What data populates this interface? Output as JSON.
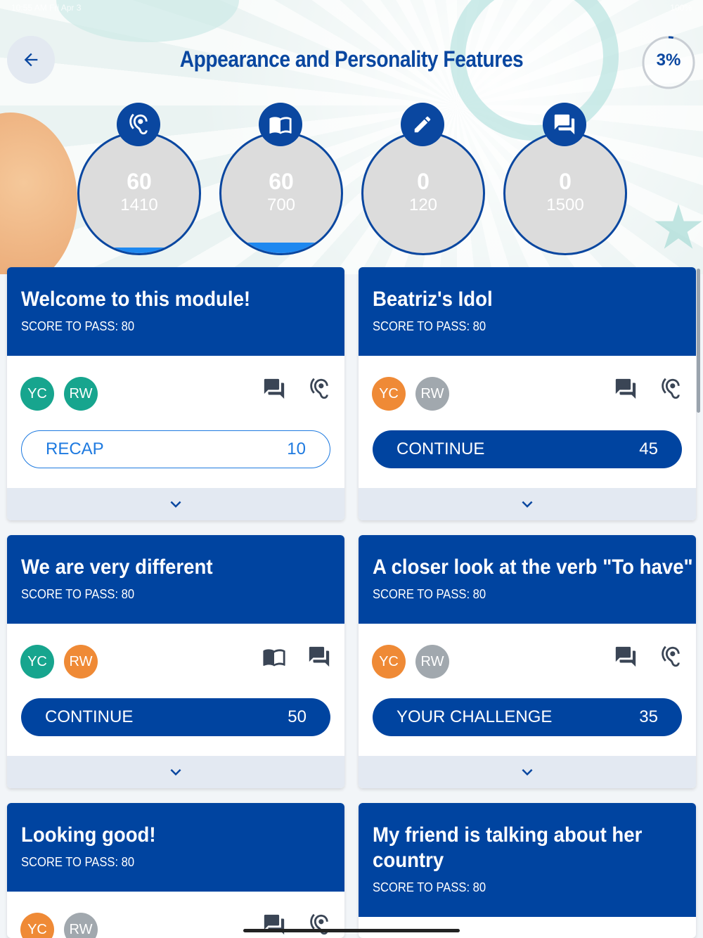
{
  "status_bar": {
    "time": "10:55 AM",
    "date": "Fri Apr 3",
    "battery": "100%"
  },
  "header": {
    "title": "Appearance and Personality Features",
    "progress": "3%",
    "progress_fraction": 0.03
  },
  "skills": [
    {
      "icon": "ear-icon",
      "points": "60",
      "total": "1410",
      "fill_fraction": 0.043
    },
    {
      "icon": "book-icon",
      "points": "60",
      "total": "700",
      "fill_fraction": 0.086
    },
    {
      "icon": "pencil-icon",
      "points": "0",
      "total": "120",
      "fill_fraction": 0
    },
    {
      "icon": "chat-icon",
      "points": "0",
      "total": "1500",
      "fill_fraction": 0
    }
  ],
  "cards": [
    {
      "title": "Welcome to this module!",
      "pass": "SCORE TO PASS: 80",
      "avatars": [
        "YC",
        "RW"
      ],
      "avatar_colors": [
        "#17a58e",
        "#17a58e"
      ],
      "icons": [
        "chat-icon",
        "ear-icon"
      ],
      "action": "RECAP",
      "action_value": "10",
      "action_style": "outline"
    },
    {
      "title": "Beatriz's Idol",
      "pass": "SCORE TO PASS: 80",
      "avatars": [
        "YC",
        "RW"
      ],
      "avatar_colors": [
        "#ef8a36",
        "#a1a8ae"
      ],
      "icons": [
        "chat-icon",
        "ear-icon"
      ],
      "action": "CONTINUE",
      "action_value": "45",
      "action_style": "filled"
    },
    {
      "title": "We are very different",
      "pass": "SCORE TO PASS: 80",
      "avatars": [
        "YC",
        "RW"
      ],
      "avatar_colors": [
        "#17a58e",
        "#ef8a36"
      ],
      "icons": [
        "book-icon",
        "chat-icon"
      ],
      "action": "CONTINUE",
      "action_value": "50",
      "action_style": "filled"
    },
    {
      "title": "A closer look at the verb \"To have\"",
      "pass": "SCORE TO PASS: 80",
      "avatars": [
        "YC",
        "RW"
      ],
      "avatar_colors": [
        "#ef8a36",
        "#a1a8ae"
      ],
      "icons": [
        "chat-icon",
        "ear-icon"
      ],
      "action": "YOUR CHALLENGE",
      "action_value": "35",
      "action_style": "filled"
    },
    {
      "title": "Looking good!",
      "pass": "SCORE TO PASS: 80",
      "avatars": [
        "YC",
        "RW"
      ],
      "avatar_colors": [
        "#ef8a36",
        "#a1a8ae"
      ],
      "icons": [
        "chat-icon",
        "ear-icon"
      ]
    },
    {
      "title": "My friend is talking about her country",
      "pass": "SCORE TO PASS: 80"
    }
  ]
}
